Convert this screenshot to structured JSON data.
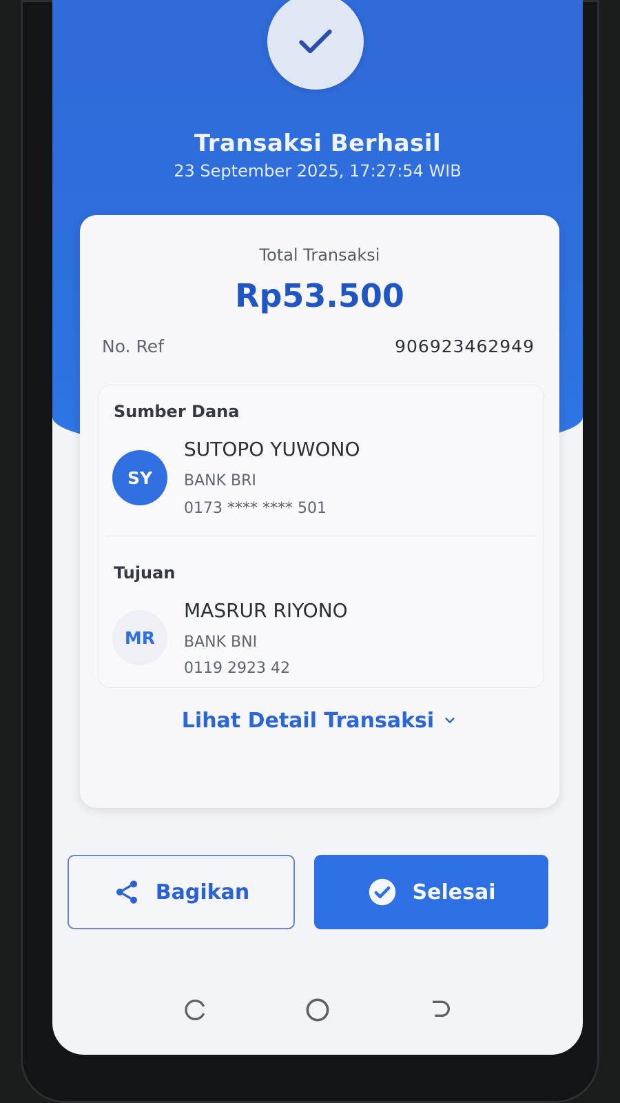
{
  "header": {
    "title": "Transaksi Berhasil",
    "datetime": "23 September 2025, 17:27:54 WIB",
    "status_icon": "check-icon"
  },
  "summary": {
    "total_label": "Total Transaksi",
    "total_amount": "Rp53.500",
    "ref_label": "No. Ref",
    "ref_value": "906923462949"
  },
  "source": {
    "section_label": "Sumber Dana",
    "initials": "SY",
    "name": "SUTOPO YUWONO",
    "bank": "BANK BRI",
    "account": "0173 **** **** 501"
  },
  "destination": {
    "section_label": "Tujuan",
    "initials": "MR",
    "name": "MASRUR RIYONO",
    "bank": "BANK BNI",
    "account": "0119 2923 42"
  },
  "detail_link": {
    "label": "Lihat Detail Transaksi",
    "icon": "chevron-down-icon"
  },
  "actions": {
    "share_label": "Bagikan",
    "share_icon": "share-icon",
    "done_label": "Selesai",
    "done_icon": "check-circle-icon"
  },
  "system_nav": {
    "icons": [
      "recents-icon",
      "home-icon",
      "back-icon"
    ]
  },
  "colors": {
    "primary": "#2e6fe3",
    "header_blue": "#2f6bd9",
    "amount_blue": "#1f56c4"
  }
}
